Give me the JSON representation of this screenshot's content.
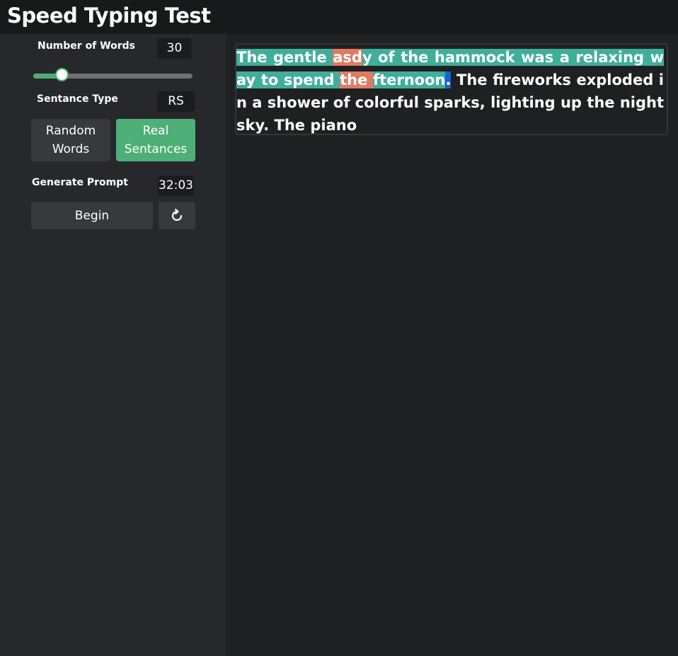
{
  "header": {
    "title": "Speed Typing Test"
  },
  "settings": {
    "words_label": "Number of Words",
    "words_value": "30",
    "slider_fraction": 0.18,
    "sentence_type_label": "Sentance Type",
    "sentence_type_value": "RS",
    "random_words_label": "Random Words",
    "real_sentences_label": "Real Sentances",
    "generate_label": "Generate Prompt",
    "timer": "32:03",
    "begin_label": "Begin",
    "reset_icon": "refresh-icon"
  },
  "prompt": {
    "segments": [
      {
        "text": "The gentle ",
        "state": "correct"
      },
      {
        "text": "asd",
        "state": "error"
      },
      {
        "text": "y of the hammock was a relaxing way to spend ",
        "state": "correct"
      },
      {
        "text": " the ",
        "state": "error"
      },
      {
        "text": "fternoon",
        "state": "correct"
      },
      {
        "text": ".",
        "state": "cursor"
      },
      {
        "text": " The fireworks exploded in a shower of colorful sparks, lighting up the night sky. The piano",
        "state": "pending"
      }
    ]
  },
  "colors": {
    "accent_green": "#4faf78",
    "correct": "#3fae9a",
    "error": "#e07a62",
    "cursor": "#1565d8"
  }
}
